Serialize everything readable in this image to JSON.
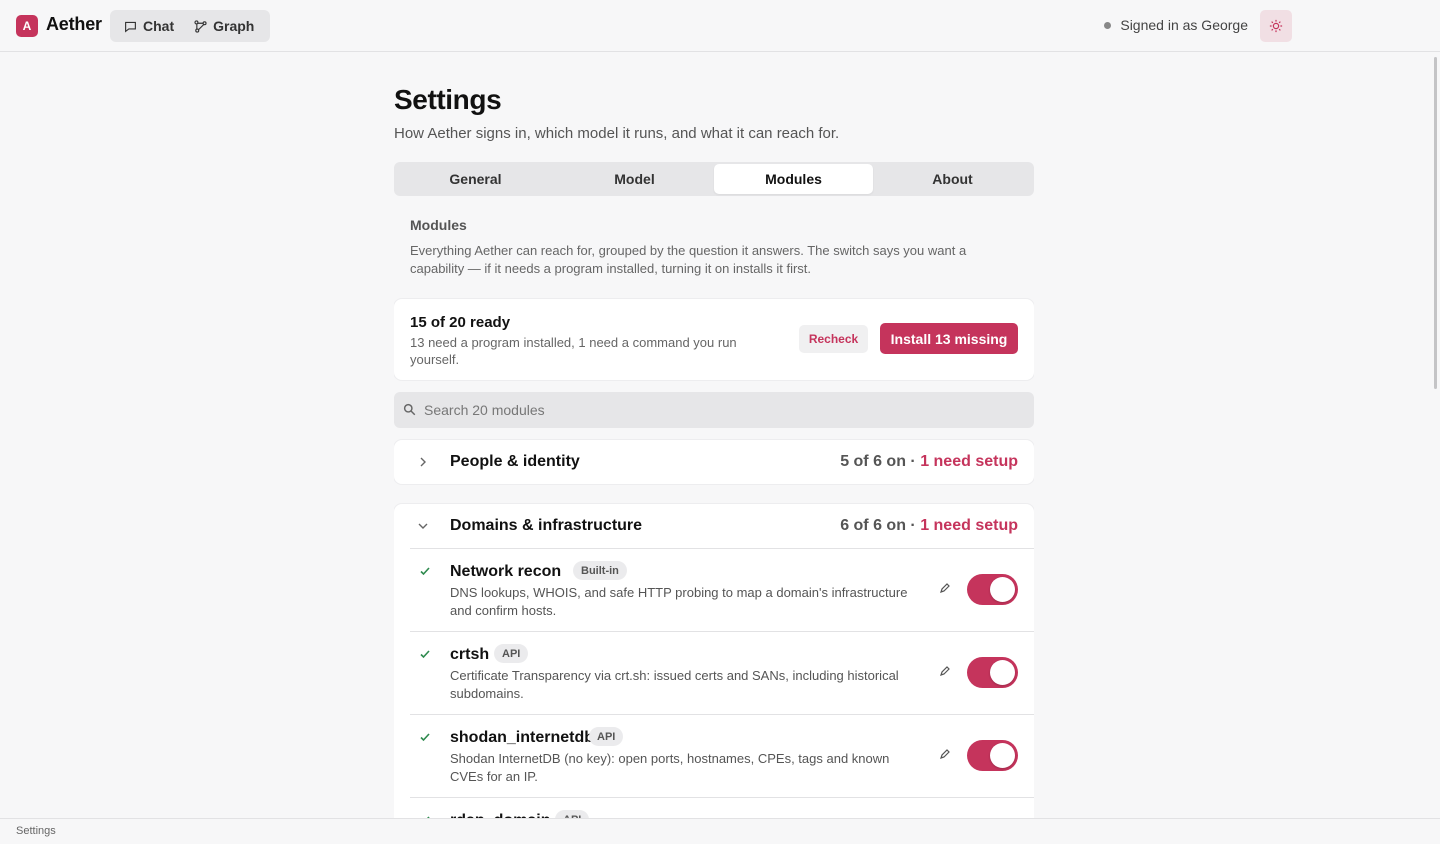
{
  "app": {
    "logo_letter": "A",
    "name": "Aether",
    "nav": [
      {
        "label": "Chat",
        "icon": "chat-bubble-icon"
      },
      {
        "label": "Graph",
        "icon": "graph-icon"
      }
    ],
    "signed_in": "Signed in as George",
    "theme_icon": "sun-icon",
    "accent": "#c5345c"
  },
  "page": {
    "title": "Settings",
    "subtitle": "How Aether signs in, which model it runs, and what it can reach for."
  },
  "tabs": [
    {
      "label": "General"
    },
    {
      "label": "Model"
    },
    {
      "label": "Modules",
      "active": true
    },
    {
      "label": "About"
    }
  ],
  "modules_section": {
    "label": "Modules",
    "description": "Everything Aether can reach for, grouped by the question it answers. The switch says you want a capability — if it needs a program installed, turning it on installs it first."
  },
  "summary": {
    "title": "15 of 20 ready",
    "detail": "13 need a program installed, 1 need a command you run yourself.",
    "recheck_label": "Recheck",
    "install_label": "Install 13 missing"
  },
  "search": {
    "placeholder": "Search 20 modules",
    "value": ""
  },
  "groups": [
    {
      "title": "People & identity",
      "status_count": "5 of 6 on · ",
      "status_setup": "1 need setup",
      "expanded": false
    },
    {
      "title": "Domains & infrastructure",
      "status_count": "6 of 6 on · ",
      "status_setup": "1 need setup",
      "expanded": true,
      "modules": [
        {
          "name": "Network recon",
          "badge": "Built-in",
          "description": "DNS lookups, WHOIS, and safe HTTP probing to map a domain's infrastructure and confirm hosts.",
          "ready": true,
          "enabled": true
        },
        {
          "name": "crtsh",
          "badge": "API",
          "description": "Certificate Transparency via crt.sh: issued certs and SANs, including historical subdomains.",
          "ready": true,
          "enabled": true
        },
        {
          "name": "shodan_internetdb",
          "badge": "API",
          "description": "Shodan InternetDB (no key): open ports, hostnames, CPEs, tags and known CVEs for an IP.",
          "ready": true,
          "enabled": true
        },
        {
          "name": "rdap_domain",
          "badge": "API",
          "description": "",
          "ready": true,
          "enabled": true
        }
      ]
    }
  ],
  "statusbar": {
    "text": "Settings"
  }
}
